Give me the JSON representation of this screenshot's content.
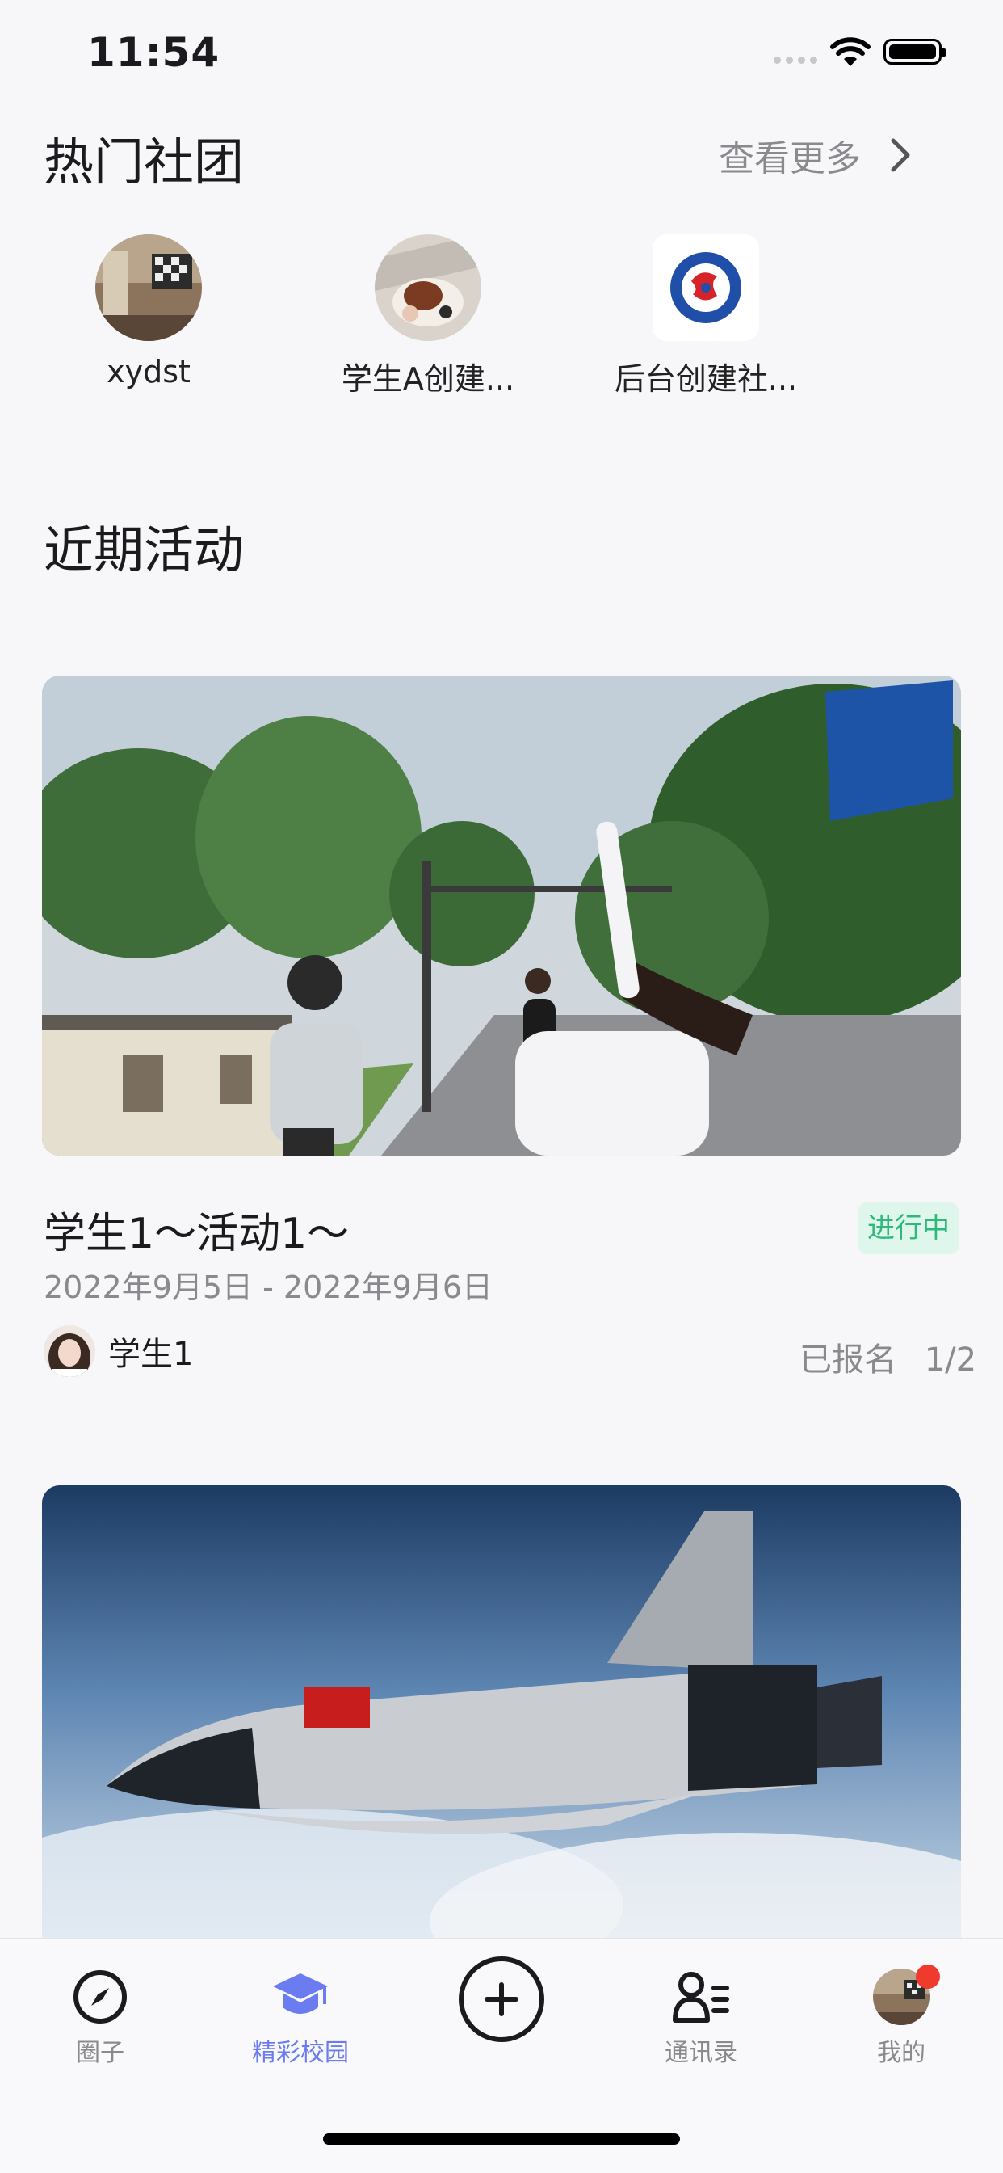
{
  "status_bar": {
    "time": "11:54"
  },
  "clubs_section": {
    "title": "热门社团",
    "more_label": "查看更多",
    "clubs": [
      {
        "name": "xydst"
      },
      {
        "name": "学生A创建..."
      },
      {
        "name": "后台创建社..."
      }
    ]
  },
  "activities_section": {
    "title": "近期活动",
    "activities": [
      {
        "title": "学生1～活动1～",
        "status": "进行中",
        "date_range": "2022年9月5日 - 2022年9月6日",
        "organizer": "学生1",
        "enroll_label": "已报名",
        "enroll_count": "1/2"
      }
    ]
  },
  "tab_bar": {
    "tabs": [
      {
        "label": "圈子",
        "icon": "compass-icon"
      },
      {
        "label": "精彩校园",
        "icon": "graduation-cap-icon"
      },
      {
        "label": "",
        "icon": "add-circle-icon"
      },
      {
        "label": "通讯录",
        "icon": "contacts-icon"
      },
      {
        "label": "我的",
        "icon": "avatar-icon"
      }
    ],
    "active_tab": "精彩校园",
    "accent_color": "#6b7cf0"
  }
}
